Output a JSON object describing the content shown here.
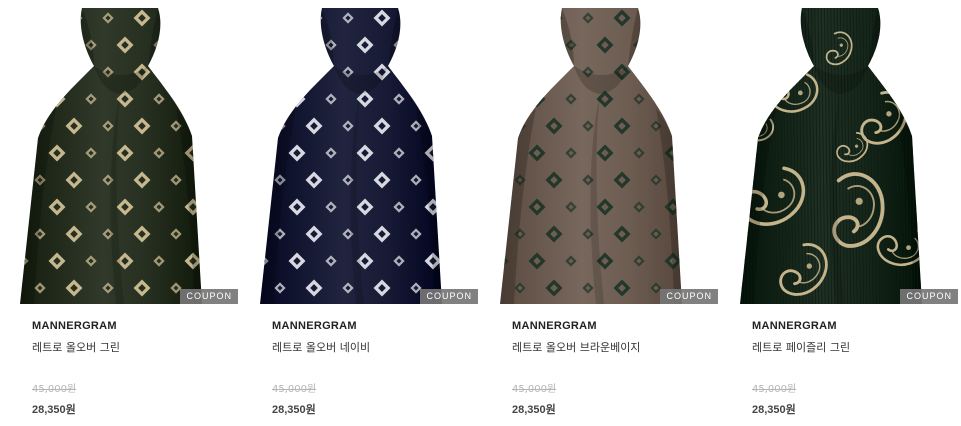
{
  "products": [
    {
      "brand": "MANNERGRAM",
      "name": "레트로 올오버 그린",
      "original_price": "45,000원",
      "sale_price": "28,350원",
      "badge": "COUPON",
      "tie_color": "#262f20",
      "pattern_color": "#cdbf95",
      "pattern": "diamond-dots"
    },
    {
      "brand": "MANNERGRAM",
      "name": "레트로 올오버 네이비",
      "original_price": "45,000원",
      "sale_price": "28,350원",
      "badge": "COUPON",
      "tie_color": "#171a35",
      "pattern_color": "#e3e3ea",
      "pattern": "diamond-dots"
    },
    {
      "brand": "MANNERGRAM",
      "name": "레트로 올오버 브라운베이지",
      "original_price": "45,000원",
      "sale_price": "28,350원",
      "badge": "COUPON",
      "tie_color": "#6d5d52",
      "pattern_color": "#1f3528",
      "pattern": "diamond-dots"
    },
    {
      "brand": "MANNERGRAM",
      "name": "레트로 페이즐리 그린",
      "original_price": "45,000원",
      "sale_price": "28,350원",
      "badge": "COUPON",
      "tie_color": "#16261b",
      "pattern_color": "#c3b48c",
      "pattern": "paisley"
    }
  ]
}
